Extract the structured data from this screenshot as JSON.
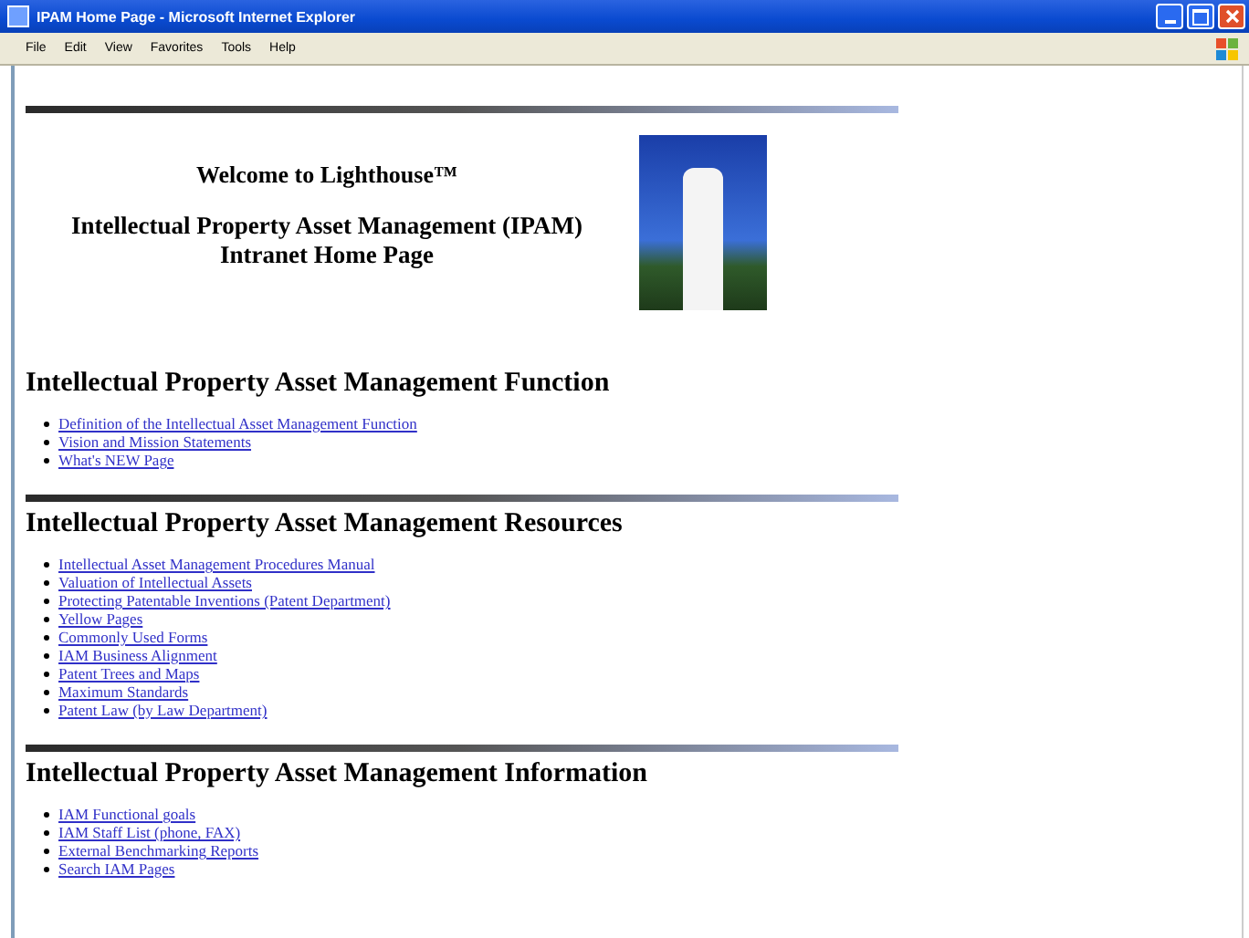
{
  "window": {
    "title": "IPAM Home Page - Microsoft Internet Explorer"
  },
  "menu": [
    "File",
    "Edit",
    "View",
    "Favorites",
    "Tools",
    "Help"
  ],
  "header": {
    "welcome": "Welcome to Lighthouse™",
    "title": "Intellectual Property Asset Management (IPAM)",
    "subtitle": "Intranet Home Page"
  },
  "sections": [
    {
      "heading": "Intellectual Property Asset Management Function",
      "rule_above": false,
      "links": [
        "Definition of the Intellectual Asset Management Function",
        "Vision and Mission Statements",
        "What's NEW Page"
      ]
    },
    {
      "heading": "Intellectual Property Asset Management Resources",
      "rule_above": true,
      "links": [
        "Intellectual Asset Management Procedures Manual",
        "Valuation of Intellectual Assets",
        "Protecting Patentable Inventions (Patent Department)",
        "Yellow Pages",
        "Commonly Used Forms",
        "IAM Business Alignment",
        "Patent Trees and Maps",
        "Maximum Standards",
        "Patent Law (by Law Department)"
      ]
    },
    {
      "heading": "Intellectual Property Asset Management Information",
      "rule_above": true,
      "links": [
        "IAM Functional goals",
        "IAM Staff List (phone, FAX)",
        "External Benchmarking Reports",
        "Search IAM Pages"
      ]
    }
  ]
}
